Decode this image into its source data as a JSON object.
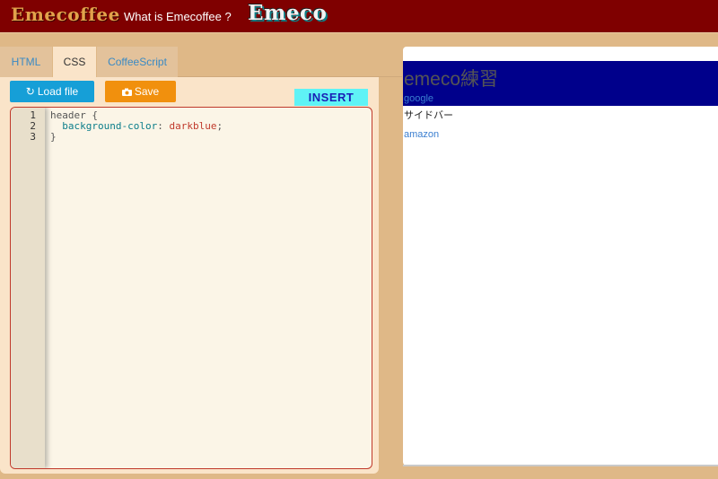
{
  "header": {
    "brand": "Emecoffee",
    "what_is": "What is Emecoffee ?",
    "logo_text": "Emeco"
  },
  "tabs": [
    {
      "label": "HTML",
      "active": false
    },
    {
      "label": "CSS",
      "active": true
    },
    {
      "label": "CoffeeScript",
      "active": false
    }
  ],
  "toolbar": {
    "load_label": "Load file",
    "load_icon": "refresh-icon",
    "save_label": "Save",
    "save_icon": "camera-icon",
    "insert_label": "INSERT"
  },
  "editor": {
    "line_numbers": [
      "1",
      "2",
      "3"
    ],
    "lines": {
      "l1": "header {",
      "l2_prop": "background-color",
      "l2_sep": ": ",
      "l2_val": "darkblue",
      "l2_end": ";",
      "l3": "}"
    }
  },
  "preview": {
    "title": "emeco練習",
    "link1": "google",
    "sidebar_text": "サイドバー",
    "link2": "amazon",
    "header_bg": "#00008b"
  },
  "colors": {
    "topbar": "#7f0000",
    "page_bg": "#dfb887",
    "load_btn": "#169fd7",
    "save_btn": "#f1900d",
    "insert_btn": "#5ff3f6"
  }
}
